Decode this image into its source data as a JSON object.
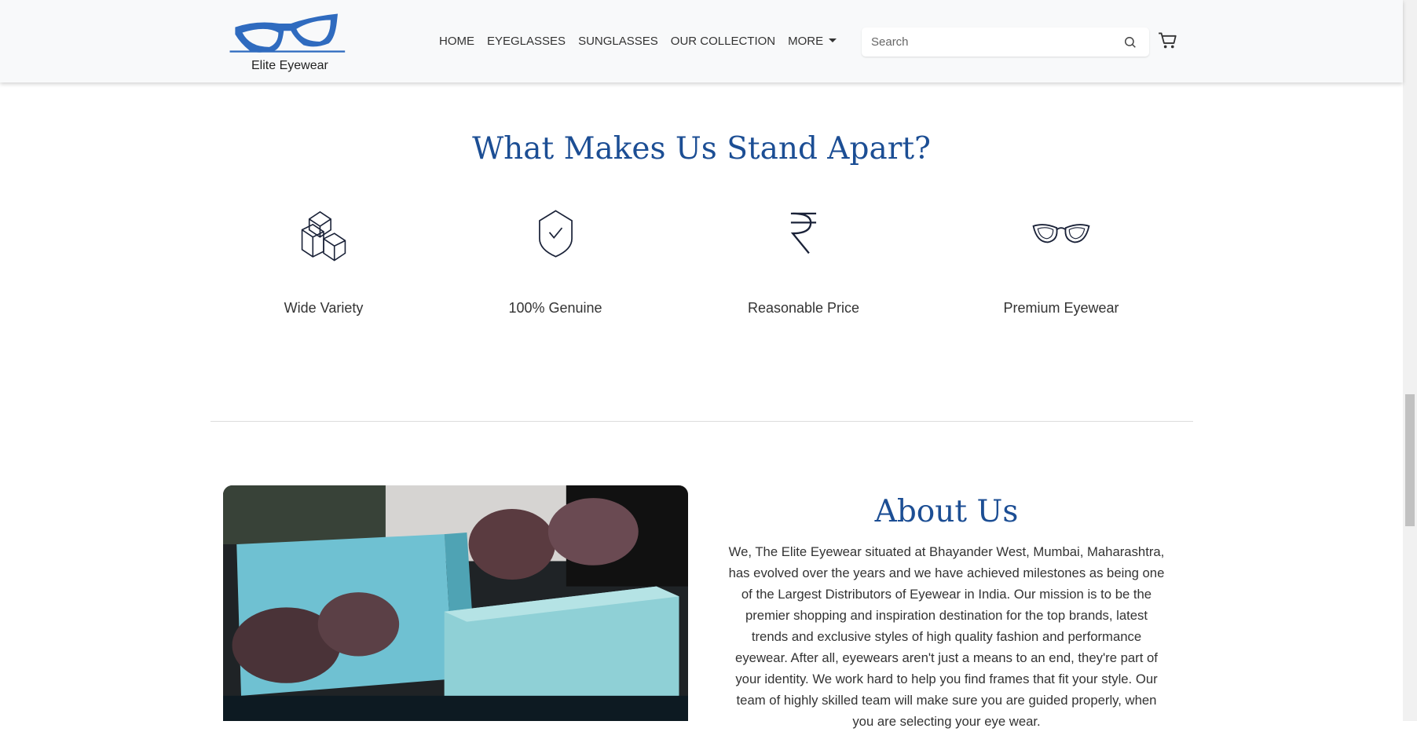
{
  "brand": {
    "name": "Elite Eyewear",
    "color": "#2f6bbf"
  },
  "nav": {
    "items": [
      "HOME",
      "EYEGLASSES",
      "SUNGLASSES",
      "OUR COLLECTION",
      "MORE"
    ]
  },
  "search": {
    "placeholder": "Search",
    "value": ""
  },
  "features": {
    "title": "What Makes Us Stand Apart?",
    "items": [
      {
        "label": "Wide Variety",
        "icon": "boxes-icon"
      },
      {
        "label": "100% Genuine",
        "icon": "shield-check-icon"
      },
      {
        "label": "Reasonable Price",
        "icon": "rupee-icon"
      },
      {
        "label": "Premium Eyewear",
        "icon": "cat-eye-glasses-icon"
      }
    ]
  },
  "about": {
    "title": "About Us",
    "lines": [
      "We, The Elite Eyewear situated at Bhayander West, Mumbai, Maharashtra,",
      "has evolved over the years and we have achieved milestones as being one",
      "of the Largest Distributors of Eyewear in India. Our mission is to be the",
      "premier shopping and inspiration destination for the top brands, latest",
      "trends and exclusive styles of high quality fashion and performance",
      "eyewear. After all, eyewears aren't just a means to an end, they're part of",
      "your identity. We work hard to help you find frames that fit your style. Our",
      "team of highly skilled team will make sure you are guided properly, when",
      "you are selecting your eye wear."
    ]
  },
  "colors": {
    "heading": "#1c4e94",
    "nav_bg": "#f8f9fa"
  }
}
